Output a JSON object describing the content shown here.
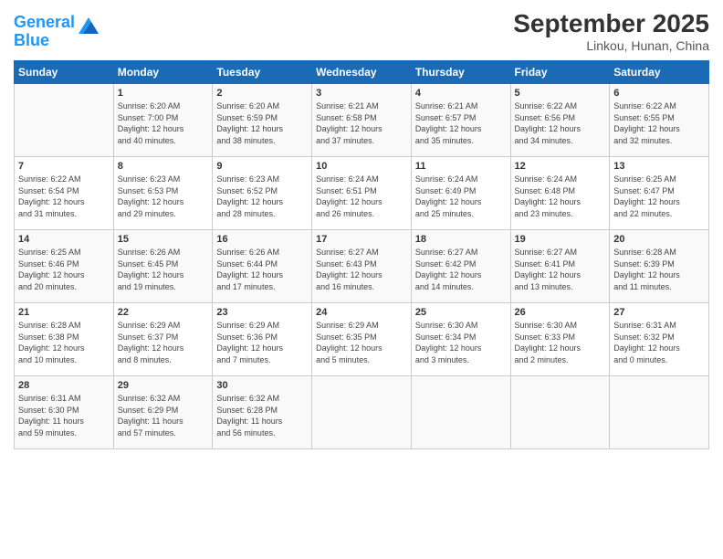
{
  "header": {
    "logo_line1": "General",
    "logo_line2": "Blue",
    "main_title": "September 2025",
    "subtitle": "Linkou, Hunan, China"
  },
  "columns": [
    "Sunday",
    "Monday",
    "Tuesday",
    "Wednesday",
    "Thursday",
    "Friday",
    "Saturday"
  ],
  "weeks": [
    [
      {
        "day": "",
        "info": ""
      },
      {
        "day": "1",
        "info": "Sunrise: 6:20 AM\nSunset: 7:00 PM\nDaylight: 12 hours\nand 40 minutes."
      },
      {
        "day": "2",
        "info": "Sunrise: 6:20 AM\nSunset: 6:59 PM\nDaylight: 12 hours\nand 38 minutes."
      },
      {
        "day": "3",
        "info": "Sunrise: 6:21 AM\nSunset: 6:58 PM\nDaylight: 12 hours\nand 37 minutes."
      },
      {
        "day": "4",
        "info": "Sunrise: 6:21 AM\nSunset: 6:57 PM\nDaylight: 12 hours\nand 35 minutes."
      },
      {
        "day": "5",
        "info": "Sunrise: 6:22 AM\nSunset: 6:56 PM\nDaylight: 12 hours\nand 34 minutes."
      },
      {
        "day": "6",
        "info": "Sunrise: 6:22 AM\nSunset: 6:55 PM\nDaylight: 12 hours\nand 32 minutes."
      }
    ],
    [
      {
        "day": "7",
        "info": "Sunrise: 6:22 AM\nSunset: 6:54 PM\nDaylight: 12 hours\nand 31 minutes."
      },
      {
        "day": "8",
        "info": "Sunrise: 6:23 AM\nSunset: 6:53 PM\nDaylight: 12 hours\nand 29 minutes."
      },
      {
        "day": "9",
        "info": "Sunrise: 6:23 AM\nSunset: 6:52 PM\nDaylight: 12 hours\nand 28 minutes."
      },
      {
        "day": "10",
        "info": "Sunrise: 6:24 AM\nSunset: 6:51 PM\nDaylight: 12 hours\nand 26 minutes."
      },
      {
        "day": "11",
        "info": "Sunrise: 6:24 AM\nSunset: 6:49 PM\nDaylight: 12 hours\nand 25 minutes."
      },
      {
        "day": "12",
        "info": "Sunrise: 6:24 AM\nSunset: 6:48 PM\nDaylight: 12 hours\nand 23 minutes."
      },
      {
        "day": "13",
        "info": "Sunrise: 6:25 AM\nSunset: 6:47 PM\nDaylight: 12 hours\nand 22 minutes."
      }
    ],
    [
      {
        "day": "14",
        "info": "Sunrise: 6:25 AM\nSunset: 6:46 PM\nDaylight: 12 hours\nand 20 minutes."
      },
      {
        "day": "15",
        "info": "Sunrise: 6:26 AM\nSunset: 6:45 PM\nDaylight: 12 hours\nand 19 minutes."
      },
      {
        "day": "16",
        "info": "Sunrise: 6:26 AM\nSunset: 6:44 PM\nDaylight: 12 hours\nand 17 minutes."
      },
      {
        "day": "17",
        "info": "Sunrise: 6:27 AM\nSunset: 6:43 PM\nDaylight: 12 hours\nand 16 minutes."
      },
      {
        "day": "18",
        "info": "Sunrise: 6:27 AM\nSunset: 6:42 PM\nDaylight: 12 hours\nand 14 minutes."
      },
      {
        "day": "19",
        "info": "Sunrise: 6:27 AM\nSunset: 6:41 PM\nDaylight: 12 hours\nand 13 minutes."
      },
      {
        "day": "20",
        "info": "Sunrise: 6:28 AM\nSunset: 6:39 PM\nDaylight: 12 hours\nand 11 minutes."
      }
    ],
    [
      {
        "day": "21",
        "info": "Sunrise: 6:28 AM\nSunset: 6:38 PM\nDaylight: 12 hours\nand 10 minutes."
      },
      {
        "day": "22",
        "info": "Sunrise: 6:29 AM\nSunset: 6:37 PM\nDaylight: 12 hours\nand 8 minutes."
      },
      {
        "day": "23",
        "info": "Sunrise: 6:29 AM\nSunset: 6:36 PM\nDaylight: 12 hours\nand 7 minutes."
      },
      {
        "day": "24",
        "info": "Sunrise: 6:29 AM\nSunset: 6:35 PM\nDaylight: 12 hours\nand 5 minutes."
      },
      {
        "day": "25",
        "info": "Sunrise: 6:30 AM\nSunset: 6:34 PM\nDaylight: 12 hours\nand 3 minutes."
      },
      {
        "day": "26",
        "info": "Sunrise: 6:30 AM\nSunset: 6:33 PM\nDaylight: 12 hours\nand 2 minutes."
      },
      {
        "day": "27",
        "info": "Sunrise: 6:31 AM\nSunset: 6:32 PM\nDaylight: 12 hours\nand 0 minutes."
      }
    ],
    [
      {
        "day": "28",
        "info": "Sunrise: 6:31 AM\nSunset: 6:30 PM\nDaylight: 11 hours\nand 59 minutes."
      },
      {
        "day": "29",
        "info": "Sunrise: 6:32 AM\nSunset: 6:29 PM\nDaylight: 11 hours\nand 57 minutes."
      },
      {
        "day": "30",
        "info": "Sunrise: 6:32 AM\nSunset: 6:28 PM\nDaylight: 11 hours\nand 56 minutes."
      },
      {
        "day": "",
        "info": ""
      },
      {
        "day": "",
        "info": ""
      },
      {
        "day": "",
        "info": ""
      },
      {
        "day": "",
        "info": ""
      }
    ]
  ]
}
